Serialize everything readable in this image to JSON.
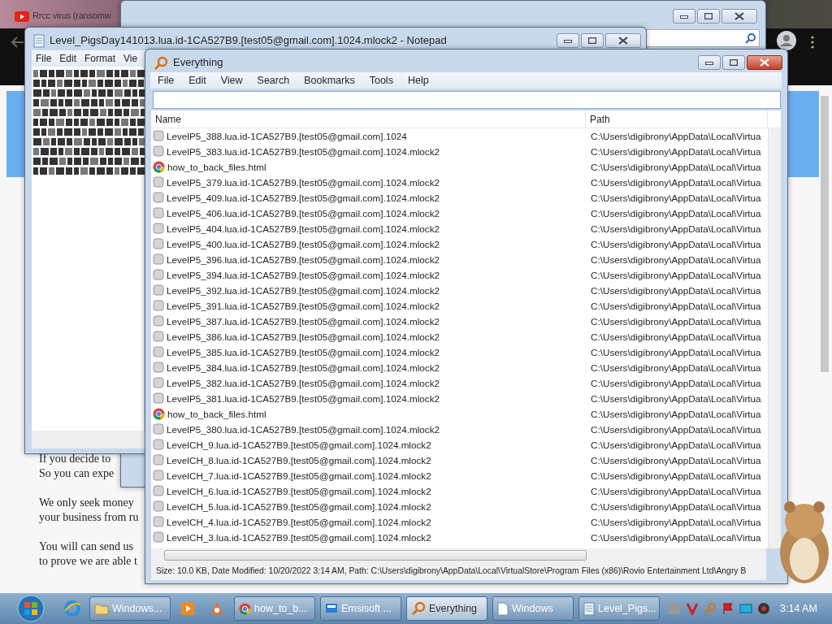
{
  "browser": {
    "tab_title": "Rrcc virus (ransomw",
    "paragraphs": [
      [
        "If you decide to",
        "So you can expe"
      ],
      [
        "We only seek money",
        "your business from ru"
      ],
      [
        "You will can send us",
        "to prove we are able t"
      ]
    ]
  },
  "notepad": {
    "title": "Level_PigsDay141013.lua.id-1CA527B9.[test05@gmail.com].1024.mlock2 - Notepad",
    "menu": [
      "File",
      "Edit",
      "Format",
      "Vie"
    ]
  },
  "everything": {
    "title": "Everything",
    "menu": [
      "File",
      "Edit",
      "View",
      "Search",
      "Bookmarks",
      "Tools",
      "Help"
    ],
    "columns": [
      "Name",
      "Path"
    ],
    "rows": [
      {
        "kind": "file",
        "name": "LevelP5_388.lua.id-1CA527B9.[test05@gmail.com].1024",
        "path": "C:\\Users\\digibrony\\AppData\\Local\\Virtua"
      },
      {
        "kind": "file",
        "name": "LevelP5_383.lua.id-1CA527B9.[test05@gmail.com].1024.mlock2",
        "path": "C:\\Users\\digibrony\\AppData\\Local\\Virtua"
      },
      {
        "kind": "html",
        "name": "how_to_back_files.html",
        "path": "C:\\Users\\digibrony\\AppData\\Local\\Virtua"
      },
      {
        "kind": "file",
        "name": "LevelP5_379.lua.id-1CA527B9.[test05@gmail.com].1024.mlock2",
        "path": "C:\\Users\\digibrony\\AppData\\Local\\Virtua"
      },
      {
        "kind": "file",
        "name": "LevelP5_409.lua.id-1CA527B9.[test05@gmail.com].1024.mlock2",
        "path": "C:\\Users\\digibrony\\AppData\\Local\\Virtua"
      },
      {
        "kind": "file",
        "name": "LevelP5_406.lua.id-1CA527B9.[test05@gmail.com].1024.mlock2",
        "path": "C:\\Users\\digibrony\\AppData\\Local\\Virtua"
      },
      {
        "kind": "file",
        "name": "LevelP5_404.lua.id-1CA527B9.[test05@gmail.com].1024.mlock2",
        "path": "C:\\Users\\digibrony\\AppData\\Local\\Virtua"
      },
      {
        "kind": "file",
        "name": "LevelP5_400.lua.id-1CA527B9.[test05@gmail.com].1024.mlock2",
        "path": "C:\\Users\\digibrony\\AppData\\Local\\Virtua"
      },
      {
        "kind": "file",
        "name": "LevelP5_396.lua.id-1CA527B9.[test05@gmail.com].1024.mlock2",
        "path": "C:\\Users\\digibrony\\AppData\\Local\\Virtua"
      },
      {
        "kind": "file",
        "name": "LevelP5_394.lua.id-1CA527B9.[test05@gmail.com].1024.mlock2",
        "path": "C:\\Users\\digibrony\\AppData\\Local\\Virtua"
      },
      {
        "kind": "file",
        "name": "LevelP5_392.lua.id-1CA527B9.[test05@gmail.com].1024.mlock2",
        "path": "C:\\Users\\digibrony\\AppData\\Local\\Virtua"
      },
      {
        "kind": "file",
        "name": "LevelP5_391.lua.id-1CA527B9.[test05@gmail.com].1024.mlock2",
        "path": "C:\\Users\\digibrony\\AppData\\Local\\Virtua"
      },
      {
        "kind": "file",
        "name": "LevelP5_387.lua.id-1CA527B9.[test05@gmail.com].1024.mlock2",
        "path": "C:\\Users\\digibrony\\AppData\\Local\\Virtua"
      },
      {
        "kind": "file",
        "name": "LevelP5_386.lua.id-1CA527B9.[test05@gmail.com].1024.mlock2",
        "path": "C:\\Users\\digibrony\\AppData\\Local\\Virtua"
      },
      {
        "kind": "file",
        "name": "LevelP5_385.lua.id-1CA527B9.[test05@gmail.com].1024.mlock2",
        "path": "C:\\Users\\digibrony\\AppData\\Local\\Virtua"
      },
      {
        "kind": "file",
        "name": "LevelP5_384.lua.id-1CA527B9.[test05@gmail.com].1024.mlock2",
        "path": "C:\\Users\\digibrony\\AppData\\Local\\Virtua"
      },
      {
        "kind": "file",
        "name": "LevelP5_382.lua.id-1CA527B9.[test05@gmail.com].1024.mlock2",
        "path": "C:\\Users\\digibrony\\AppData\\Local\\Virtua"
      },
      {
        "kind": "file",
        "name": "LevelP5_381.lua.id-1CA527B9.[test05@gmail.com].1024.mlock2",
        "path": "C:\\Users\\digibrony\\AppData\\Local\\Virtua"
      },
      {
        "kind": "html",
        "name": "how_to_back_files.html",
        "path": "C:\\Users\\digibrony\\AppData\\Local\\Virtua"
      },
      {
        "kind": "file",
        "name": "LevelP5_380.lua.id-1CA527B9.[test05@gmail.com].1024.mlock2",
        "path": "C:\\Users\\digibrony\\AppData\\Local\\Virtua"
      },
      {
        "kind": "file",
        "name": "LevelCH_9.lua.id-1CA527B9.[test05@gmail.com].1024.mlock2",
        "path": "C:\\Users\\digibrony\\AppData\\Local\\Virtua"
      },
      {
        "kind": "file",
        "name": "LevelCH_8.lua.id-1CA527B9.[test05@gmail.com].1024.mlock2",
        "path": "C:\\Users\\digibrony\\AppData\\Local\\Virtua"
      },
      {
        "kind": "file",
        "name": "LevelCH_7.lua.id-1CA527B9.[test05@gmail.com].1024.mlock2",
        "path": "C:\\Users\\digibrony\\AppData\\Local\\Virtua"
      },
      {
        "kind": "file",
        "name": "LevelCH_6.lua.id-1CA527B9.[test05@gmail.com].1024.mlock2",
        "path": "C:\\Users\\digibrony\\AppData\\Local\\Virtua"
      },
      {
        "kind": "file",
        "name": "LevelCH_5.lua.id-1CA527B9.[test05@gmail.com].1024.mlock2",
        "path": "C:\\Users\\digibrony\\AppData\\Local\\Virtua"
      },
      {
        "kind": "file",
        "name": "LevelCH_4.lua.id-1CA527B9.[test05@gmail.com].1024.mlock2",
        "path": "C:\\Users\\digibrony\\AppData\\Local\\Virtua"
      },
      {
        "kind": "file",
        "name": "LevelCH_3.lua.id-1CA527B9.[test05@gmail.com].1024.mlock2",
        "path": "C:\\Users\\digibrony\\AppData\\Local\\Virtua"
      }
    ],
    "status_bar": "Size: 10.0 KB, Date Modified: 10/20/2022 3:14 AM, Path: C:\\Users\\digibrony\\AppData\\Local\\VirtualStore\\Program Files (x86)\\Rovio Entertainment Ltd\\Angry B"
  },
  "taskbar": {
    "items": [
      {
        "kind": "ie"
      },
      {
        "kind": "folder",
        "label": "Windows...",
        "selected": false
      },
      {
        "kind": "media"
      },
      {
        "kind": "fox"
      },
      {
        "kind": "chrome",
        "label": "how_to_b...",
        "selected": false
      },
      {
        "kind": "app",
        "label": "Emsisoft ...",
        "selected": false
      },
      {
        "kind": "search",
        "label": "Everything",
        "selected": true
      },
      {
        "kind": "doc",
        "label": "Windows",
        "selected": false
      },
      {
        "kind": "notepad",
        "label": "Level_Pigs...",
        "selected": false
      }
    ],
    "clock": "3:14 AM"
  }
}
